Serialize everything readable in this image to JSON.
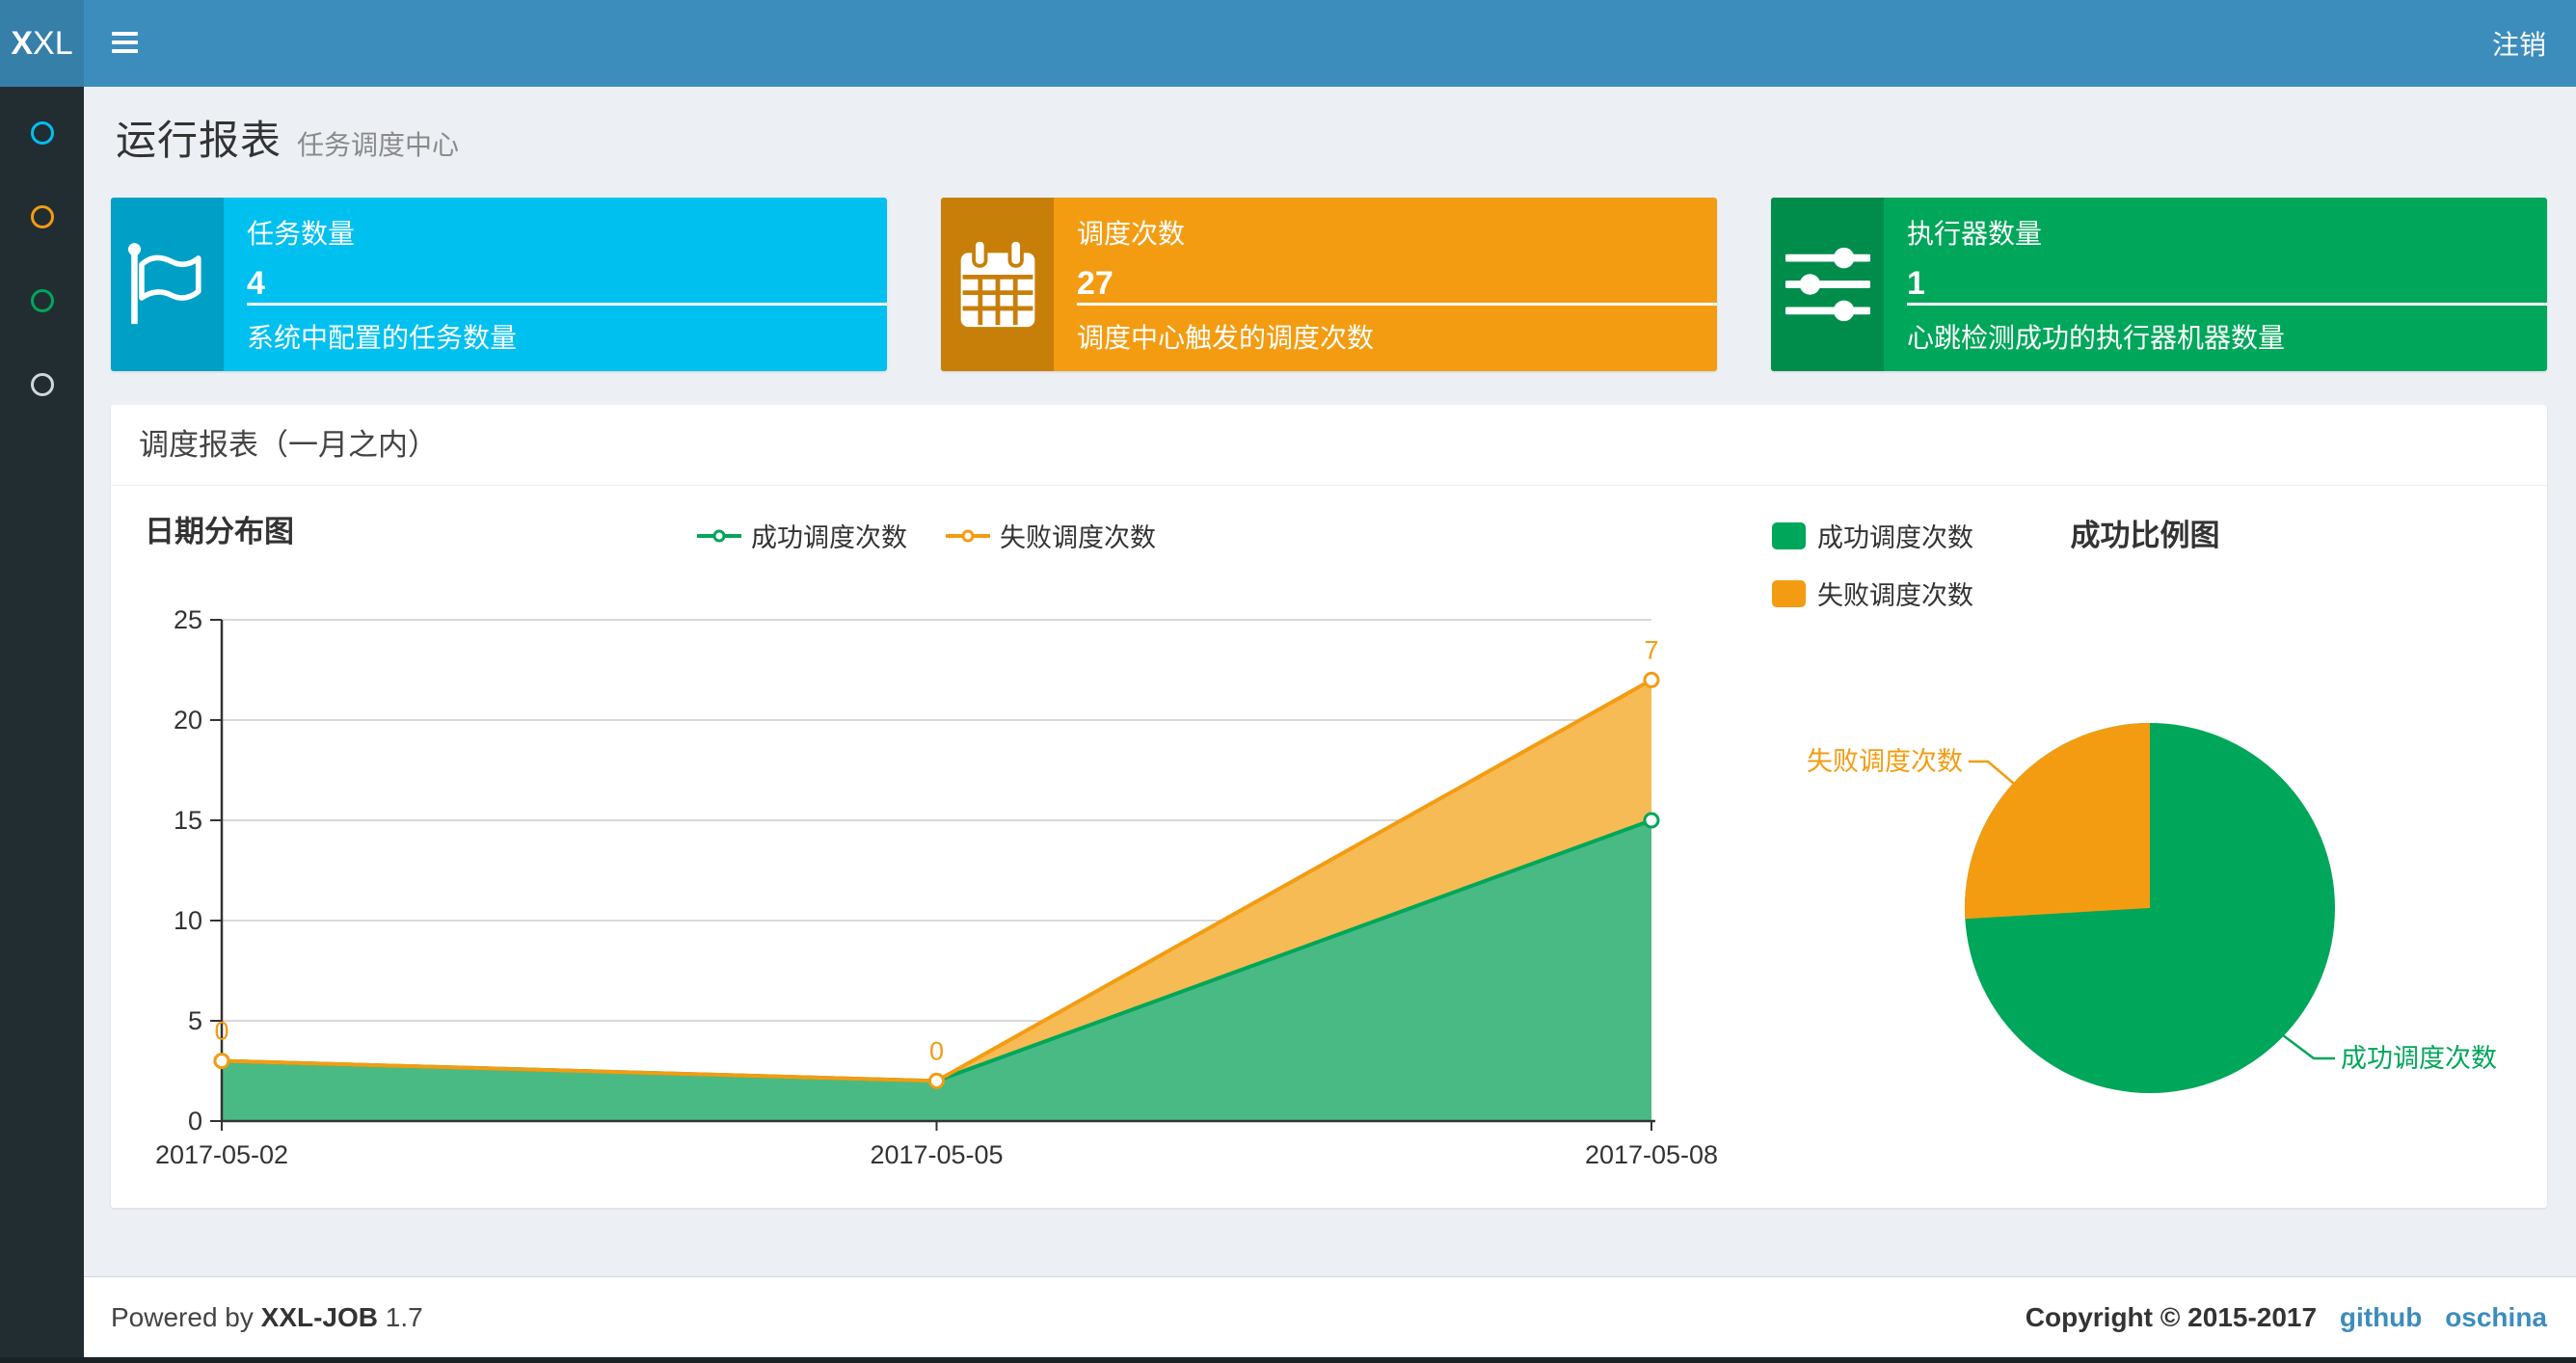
{
  "navbar": {
    "logo_bold": "X",
    "logo_rest": "XL",
    "logout_label": "注销"
  },
  "sidebar": {
    "items": [
      {
        "icon": "circle-outline-icon",
        "color": "#00c0ef"
      },
      {
        "icon": "circle-outline-icon",
        "color": "#f39c12"
      },
      {
        "icon": "circle-outline-icon",
        "color": "#00a65a"
      },
      {
        "icon": "circle-outline-icon",
        "color": "#d2d6de"
      }
    ]
  },
  "page_header": {
    "title": "运行报表",
    "subtitle": "任务调度中心"
  },
  "info_boxes": [
    {
      "icon": "flag-icon",
      "label": "任务数量",
      "value": "4",
      "description": "系统中配置的任务数量",
      "color": "#00c0ef",
      "icon_color": "#00a0c6"
    },
    {
      "icon": "calendar-icon",
      "label": "调度次数",
      "value": "27",
      "description": "调度中心触发的调度次数",
      "color": "#f39c12",
      "icon_color": "#c87f0a"
    },
    {
      "icon": "sliders-icon",
      "label": "执行器数量",
      "value": "1",
      "description": "心跳检测成功的执行器机器数量",
      "color": "#00a65a",
      "icon_color": "#008d4c"
    }
  ],
  "panel": {
    "title": "调度报表（一月之内）"
  },
  "chart_data": [
    {
      "type": "area",
      "title": "日期分布图",
      "categories": [
        "2017-05-02",
        "2017-05-05",
        "2017-05-08"
      ],
      "series": [
        {
          "name": "成功调度次数",
          "values": [
            3,
            2,
            15
          ],
          "color": "#00a65a",
          "fill": "#4aba85"
        },
        {
          "name": "失败调度次数",
          "values": [
            0,
            0,
            7
          ],
          "color": "#f39c12",
          "fill": "#f6bb54",
          "show_labels": true
        }
      ],
      "stacked": true,
      "xlabel": "",
      "ylabel": "",
      "ylim": [
        0,
        25
      ],
      "y_ticks": [
        0,
        5,
        10,
        15,
        20,
        25
      ],
      "grid": true,
      "legend_position": "top-center"
    },
    {
      "type": "pie",
      "title": "成功比例图",
      "slices": [
        {
          "label": "成功调度次数",
          "value": 20,
          "color": "#00a65a"
        },
        {
          "label": "失败调度次数",
          "value": 7,
          "color": "#f39c12"
        }
      ],
      "total": 27,
      "legend_position": "top-left"
    }
  ],
  "footer": {
    "powered_prefix": "Powered by",
    "product": "XXL-JOB",
    "version": "1.7",
    "copyright": "Copyright © 2015-2017",
    "links": [
      {
        "label": "github"
      },
      {
        "label": "oschina"
      }
    ]
  }
}
